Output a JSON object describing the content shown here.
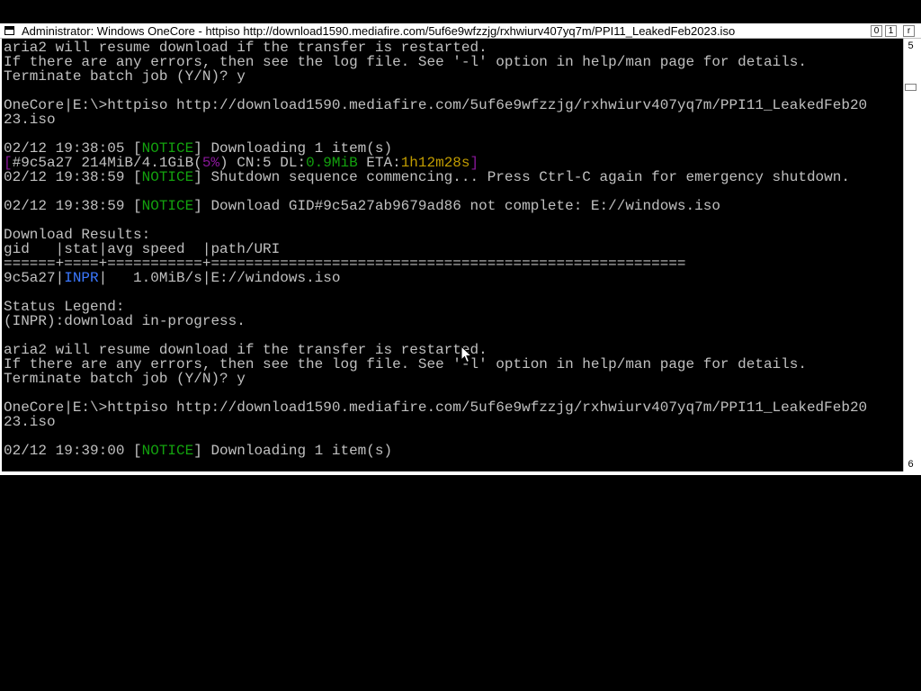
{
  "window": {
    "title": "Administrator:  Windows OneCore - httpiso  http://download1590.mediafire.com/5uf6e9wfzzjg/rxhwiurv407yq7m/PPI11_LeakedFeb2023.iso",
    "minimize_glyph": "0",
    "maximize_glyph": "1",
    "close_glyph": "r",
    "scroll_up_glyph": "5",
    "scroll_down_glyph": "6"
  },
  "colors": {
    "notice": "#13a10e",
    "status_inpr": "#3b78ff",
    "progress_highlight": "#c19c00",
    "bracket": "#881798",
    "text": "#c0c0c0"
  },
  "console": {
    "l1": "aria2 will resume download if the transfer is restarted.",
    "l2": "If there are any errors, then see the log file. See '-l' option in help/man page for details.",
    "l3": "Terminate batch job (Y/N)? y",
    "l5": "OneCore|E:\\>httpiso http://download1590.mediafire.com/5uf6e9wfzzjg/rxhwiurv407yq7m/PPI11_LeakedFeb20",
    "l6": "23.iso",
    "l8_time": "02/12 19:38:05 [",
    "l8_tag": "NOTICE",
    "l8_msg": "] Downloading 1 item(s)",
    "l9_open": "[",
    "l9_gid": "#9c5a27 214MiB/4.1GiB(",
    "l9_pct": "5%",
    "l9_mid": ") CN:5 DL:",
    "l9_dl": "0.9MiB",
    "l9_eta": " ETA:",
    "l9_eta_val": "1h12m28s",
    "l9_close": "]",
    "l10_time": "02/12 19:38:59 [",
    "l10_tag": "NOTICE",
    "l10_msg": "] Shutdown sequence commencing... Press Ctrl-C again for emergency shutdown.",
    "l12_time": "02/12 19:38:59 [",
    "l12_tag": "NOTICE",
    "l12_msg": "] Download GID#9c5a27ab9679ad86 not complete: E://windows.iso",
    "l14": "Download Results:",
    "l15": "gid   |stat|avg speed  |path/URI",
    "l16": "======+====+===========+=======================================================",
    "l17_gid": "9c5a27|",
    "l17_stat": "INPR",
    "l17_rest": "|   1.0MiB/s|E://windows.iso",
    "l19": "Status Legend:",
    "l20": "(INPR):download in-progress.",
    "l22": "aria2 will resume download if the transfer is restarted.",
    "l23": "If there are any errors, then see the log file. See '-l' option in help/man page for details.",
    "l24": "Terminate batch job (Y/N)? y",
    "l26": "OneCore|E:\\>httpiso http://download1590.mediafire.com/5uf6e9wfzzjg/rxhwiurv407yq7m/PPI11_LeakedFeb20",
    "l27": "23.iso",
    "l29_time": "02/12 19:39:00 [",
    "l29_tag": "NOTICE",
    "l29_msg": "] Downloading 1 item(s)"
  }
}
